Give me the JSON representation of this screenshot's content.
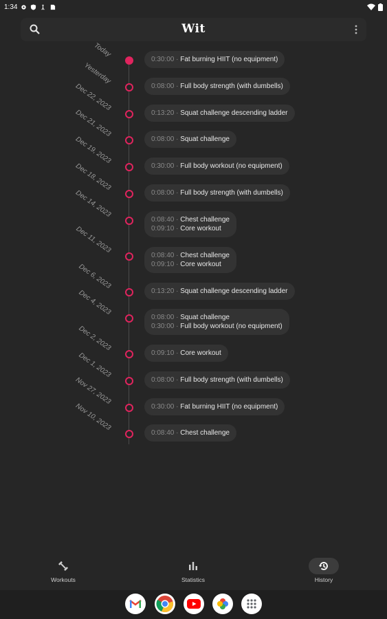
{
  "status_bar": {
    "time": "1:34"
  },
  "app_bar": {
    "title": "Wit"
  },
  "history": [
    {
      "date": "Today",
      "filled": true,
      "items": [
        {
          "duration": "0:30:00",
          "name": "Fat burning HIIT (no equipment)"
        }
      ]
    },
    {
      "date": "Yesterday",
      "filled": false,
      "items": [
        {
          "duration": "0:08:00",
          "name": "Full body strength (with dumbells)"
        }
      ]
    },
    {
      "date": "Dec 22, 2023",
      "filled": false,
      "items": [
        {
          "duration": "0:13:20",
          "name": "Squat challenge descending ladder"
        }
      ]
    },
    {
      "date": "Dec 21, 2023",
      "filled": false,
      "items": [
        {
          "duration": "0:08:00",
          "name": "Squat challenge"
        }
      ]
    },
    {
      "date": "Dec 19, 2023",
      "filled": false,
      "items": [
        {
          "duration": "0:30:00",
          "name": "Full body workout (no equipment)"
        }
      ]
    },
    {
      "date": "Dec 18, 2023",
      "filled": false,
      "items": [
        {
          "duration": "0:08:00",
          "name": "Full body strength (with dumbells)"
        }
      ]
    },
    {
      "date": "Dec 14, 2023",
      "filled": false,
      "items": [
        {
          "duration": "0:08:40",
          "name": "Chest challenge"
        },
        {
          "duration": "0:09:10",
          "name": "Core workout"
        }
      ]
    },
    {
      "date": "Dec 11, 2023",
      "filled": false,
      "items": [
        {
          "duration": "0:08:40",
          "name": "Chest challenge"
        },
        {
          "duration": "0:09:10",
          "name": "Core workout"
        }
      ]
    },
    {
      "date": "Dec 6, 2023",
      "filled": false,
      "items": [
        {
          "duration": "0:13:20",
          "name": "Squat challenge descending ladder"
        }
      ]
    },
    {
      "date": "Dec 4, 2023",
      "filled": false,
      "items": [
        {
          "duration": "0:08:00",
          "name": "Squat challenge"
        },
        {
          "duration": "0:30:00",
          "name": "Full body workout (no equipment)"
        }
      ]
    },
    {
      "date": "Dec 2, 2023",
      "filled": false,
      "items": [
        {
          "duration": "0:09:10",
          "name": "Core workout"
        }
      ]
    },
    {
      "date": "Dec 1, 2023",
      "filled": false,
      "items": [
        {
          "duration": "0:08:00",
          "name": "Full body strength (with dumbells)"
        }
      ]
    },
    {
      "date": "Nov 27, 2023",
      "filled": false,
      "items": [
        {
          "duration": "0:30:00",
          "name": "Fat burning HIIT (no equipment)"
        }
      ]
    },
    {
      "date": "Nov 10, 2023",
      "filled": false,
      "items": [
        {
          "duration": "0:08:40",
          "name": "Chest challenge"
        }
      ]
    }
  ],
  "bottom_nav": {
    "workouts": "Workouts",
    "statistics": "Statistics",
    "history": "History"
  },
  "dock_apps": [
    "Gmail",
    "Chrome",
    "YouTube",
    "Photos",
    "App drawer"
  ],
  "colors": {
    "accent": "#e0245e",
    "background": "#262626",
    "chip": "#333333"
  }
}
